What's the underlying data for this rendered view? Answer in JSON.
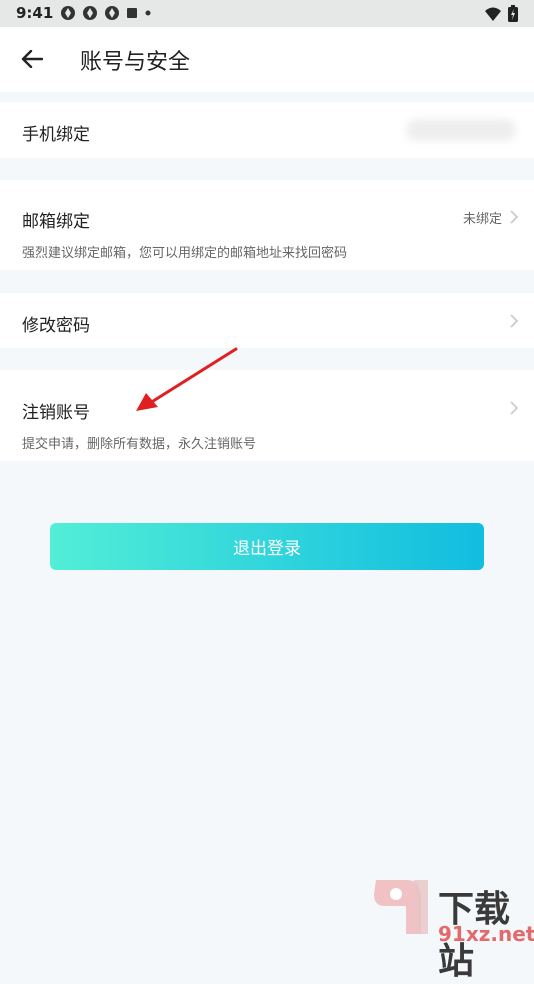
{
  "status_bar": {
    "time": "9:41"
  },
  "header": {
    "title": "账号与安全"
  },
  "items": {
    "phone": {
      "label": "手机绑定"
    },
    "email": {
      "label": "邮箱绑定",
      "status": "未绑定",
      "description": "强烈建议绑定邮箱，您可以用绑定的邮箱地址来找回密码"
    },
    "password": {
      "label": "修改密码"
    },
    "cancel": {
      "label": "注销账号",
      "description": "提交申请，删除所有数据，永久注销账号"
    }
  },
  "logout_label": "退出登录",
  "watermark": {
    "brand": "下载站",
    "domain": "91xz.net"
  },
  "colors": {
    "accent_start": "#52eed7",
    "accent_end": "#11bde0",
    "annotation_arrow": "#e02020"
  }
}
